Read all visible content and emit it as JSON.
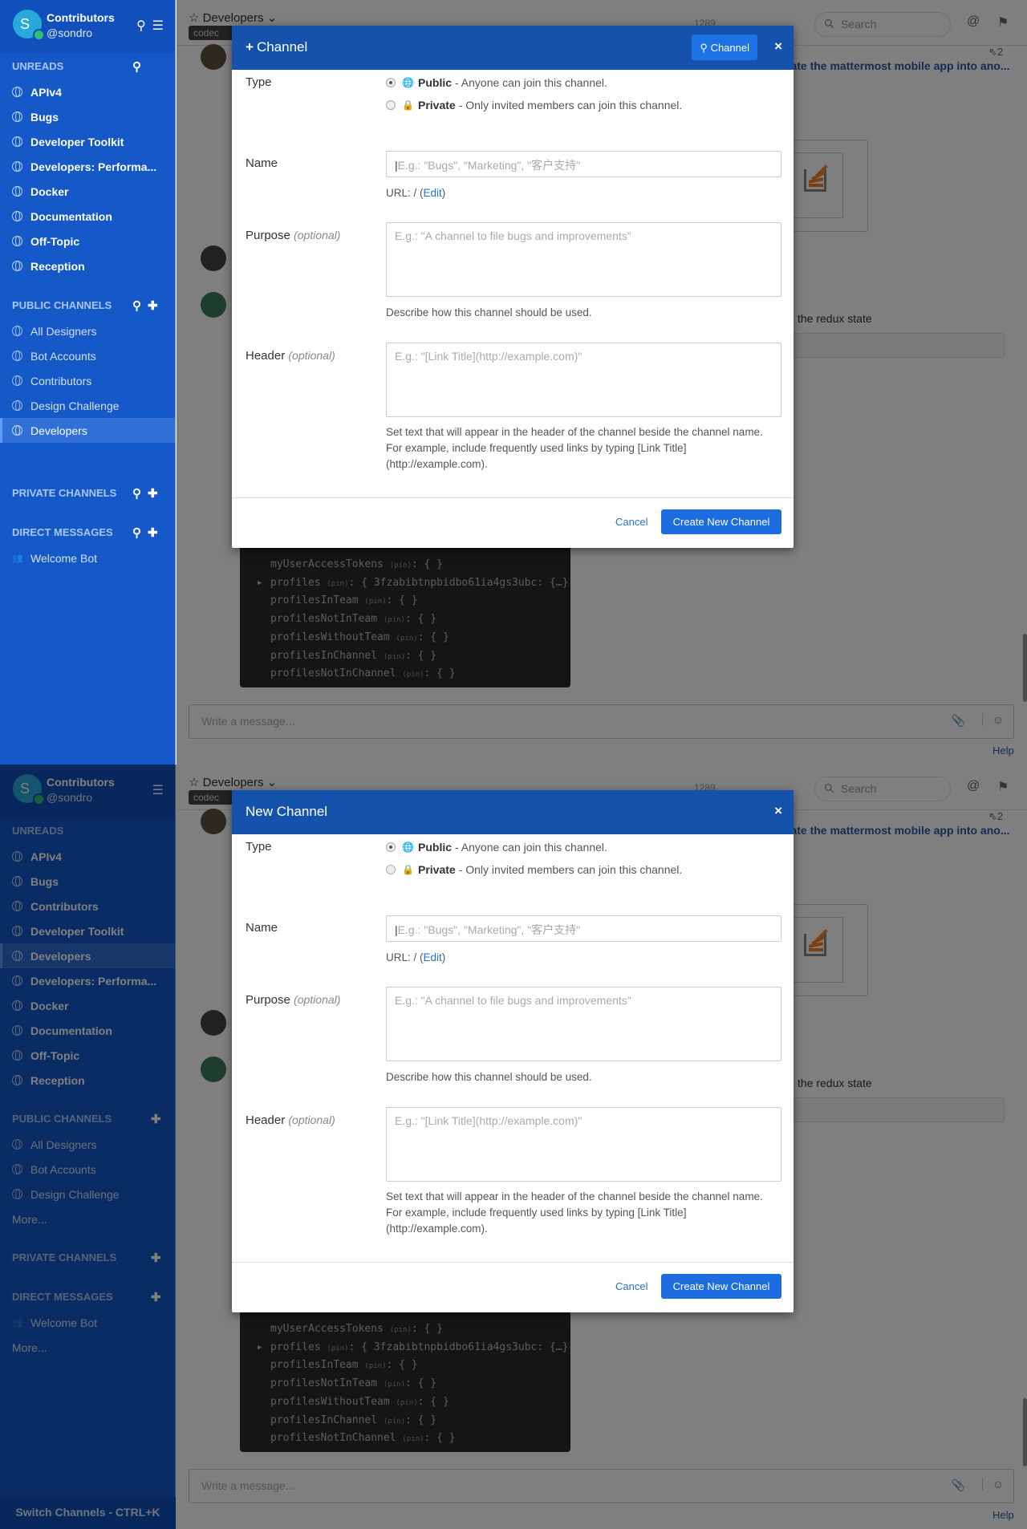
{
  "colors": {
    "sidebar": "#1558c8",
    "dialog_header": "#1552ab",
    "primary_button": "#1d6de0",
    "link": "#2670c9"
  },
  "main": {
    "channel_name": "Developers",
    "channel_tag": "codec",
    "member_count": "1289",
    "search_placeholder": "Search",
    "message_snippet": "rate the mattermost mobile app into ano...",
    "reply_count": "⇖2",
    "redux_text": "the redux state",
    "code_lines": [
      {
        "key": "myUserAccessTokens",
        "tag": "(pin)",
        "value": ": { }"
      },
      {
        "key": "profiles",
        "tag": "(pin)",
        "value": ": { 3fzabibtnpbidbo61ia4gs3ubc: {…}",
        "expandable": true
      },
      {
        "key": "profilesInTeam",
        "tag": "(pin)",
        "value": ": { }"
      },
      {
        "key": "profilesNotInTeam",
        "tag": "(pin)",
        "value": ": { }"
      },
      {
        "key": "profilesWithoutTeam",
        "tag": "(pin)",
        "value": ": { }"
      },
      {
        "key": "profilesInChannel",
        "tag": "(pin)",
        "value": ": { }"
      },
      {
        "key": "profilesNotInChannel",
        "tag": "(pin)",
        "value": ": { }"
      }
    ],
    "composer_placeholder": "Write a message...",
    "help": "Help"
  },
  "form": {
    "type_label": "Type",
    "public_label": "Public",
    "public_desc": "- Anyone can join this channel.",
    "private_label": "Private",
    "private_desc": "- Only invited members can join this channel.",
    "selected_type": "public",
    "name_label": "Name",
    "name_placeholder": "E.g.: \"Bugs\", \"Marketing\", \"客户支持\"",
    "url_prefix": "URL: / (",
    "url_edit": "Edit",
    "url_suffix": ")",
    "purpose_label": "Purpose",
    "optional": "(optional)",
    "purpose_placeholder": "E.g.: \"A channel to file bugs and improvements\"",
    "purpose_help": "Describe how this channel should be used.",
    "header_label": "Header",
    "header_placeholder": "E.g.: \"[Link Title](http://example.com)\"",
    "header_help": "Set text that will appear in the header of the channel beside the channel name. For example, include frequently used links by typing [Link Title](http://example.com).",
    "cancel": "Cancel",
    "create": "Create New Channel"
  },
  "panels": [
    {
      "sidebar": {
        "team": "Contributors",
        "user": "@sondro",
        "avatar_letter": "S",
        "header_search": true,
        "sections": [
          {
            "title": "UNREADS",
            "search": true,
            "add": false,
            "items": [
              {
                "label": "APIv4",
                "icon": "globe",
                "unread": true
              },
              {
                "label": "Bugs",
                "icon": "globe",
                "unread": true
              },
              {
                "label": "Developer Toolkit",
                "icon": "globe",
                "unread": true
              },
              {
                "label": "Developers: Performa...",
                "icon": "globe",
                "unread": true
              },
              {
                "label": "Docker",
                "icon": "globe",
                "unread": true
              },
              {
                "label": "Documentation",
                "icon": "globe",
                "unread": true
              },
              {
                "label": "Off-Topic",
                "icon": "globe",
                "unread": true
              },
              {
                "label": "Reception",
                "icon": "globe",
                "unread": true
              }
            ]
          },
          {
            "title": "PUBLIC CHANNELS",
            "search": true,
            "add": true,
            "items": [
              {
                "label": "All Designers",
                "icon": "globe"
              },
              {
                "label": "Bot Accounts",
                "icon": "globe"
              },
              {
                "label": "Contributors",
                "icon": "globe"
              },
              {
                "label": "Design Challenge",
                "icon": "globe"
              },
              {
                "label": "Developers",
                "icon": "globe",
                "active": true
              }
            ]
          },
          {
            "title": "PRIVATE CHANNELS",
            "search": true,
            "add": true,
            "items": []
          },
          {
            "title": "DIRECT MESSAGES",
            "search": true,
            "add": true,
            "items": [
              {
                "label": "Welcome Bot",
                "icon": "bot"
              }
            ]
          }
        ]
      },
      "dialog": {
        "title": "Channel",
        "title_plus": true,
        "search_button": "Channel"
      }
    },
    {
      "sidebar": {
        "team": "Contributors",
        "user": "@sondro",
        "avatar_letter": "S",
        "header_search": false,
        "sections": [
          {
            "title": "UNREADS",
            "search": false,
            "add": false,
            "items": [
              {
                "label": "APIv4",
                "icon": "globe",
                "unread": true
              },
              {
                "label": "Bugs",
                "icon": "globe",
                "unread": true
              },
              {
                "label": "Contributors",
                "icon": "globe",
                "unread": true
              },
              {
                "label": "Developer Toolkit",
                "icon": "globe",
                "unread": true
              },
              {
                "label": "Developers",
                "icon": "globe",
                "unread": true,
                "active": true
              },
              {
                "label": "Developers: Performa...",
                "icon": "globe",
                "unread": true
              },
              {
                "label": "Docker",
                "icon": "globe",
                "unread": true
              },
              {
                "label": "Documentation",
                "icon": "globe",
                "unread": true
              },
              {
                "label": "Off-Topic",
                "icon": "globe",
                "unread": true
              },
              {
                "label": "Reception",
                "icon": "globe",
                "unread": true
              }
            ]
          },
          {
            "title": "PUBLIC CHANNELS",
            "search": false,
            "add": true,
            "items": [
              {
                "label": "All Designers",
                "icon": "globe"
              },
              {
                "label": "Bot Accounts",
                "icon": "globe"
              },
              {
                "label": "Design Challenge",
                "icon": "globe"
              },
              {
                "label": "More...",
                "more": true
              }
            ]
          },
          {
            "title": "PRIVATE CHANNELS",
            "search": false,
            "add": true,
            "items": []
          },
          {
            "title": "DIRECT MESSAGES",
            "search": false,
            "add": true,
            "items": [
              {
                "label": "Welcome Bot",
                "icon": "bot"
              },
              {
                "label": "More...",
                "more": true
              }
            ]
          }
        ],
        "footer": "Switch Channels - CTRL+K"
      },
      "dialog": {
        "title": "New Channel",
        "title_plus": false
      }
    }
  ]
}
